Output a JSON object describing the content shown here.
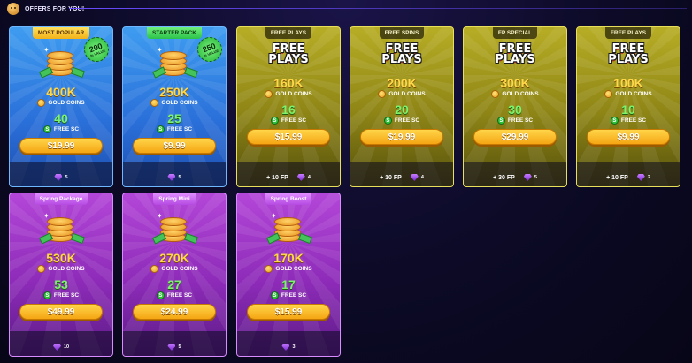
{
  "header": {
    "title": "OFFERS FOR YOU!"
  },
  "cards": [
    {
      "tag": "MOST POPULAR",
      "badge_num": "200",
      "badge_sub": "% VALUE",
      "coins": "400K",
      "coins_label": "GOLD COINS",
      "sc": "40",
      "sc_label": "FREE SC",
      "price": "$19.99",
      "fp": "",
      "gems": "5"
    },
    {
      "tag": "STARTER PACK",
      "badge_num": "250",
      "badge_sub": "% VALUE",
      "coins": "250K",
      "coins_label": "GOLD COINS",
      "sc": "25",
      "sc_label": "FREE SC",
      "price": "$9.99",
      "fp": "",
      "gems": "5"
    },
    {
      "tag": "FREE PLAYS",
      "art_line1": "FREE",
      "art_line2": "PLAYS",
      "coins": "160K",
      "coins_label": "GOLD COINS",
      "sc": "16",
      "sc_label": "FREE SC",
      "price": "$15.99",
      "fp": "+ 10 FP",
      "gems": "4"
    },
    {
      "tag": "FREE SPINS",
      "art_line1": "FREE",
      "art_line2": "PLAYS",
      "coins": "200K",
      "coins_label": "GOLD COINS",
      "sc": "20",
      "sc_label": "FREE SC",
      "price": "$19.99",
      "fp": "+ 10 FP",
      "gems": "4"
    },
    {
      "tag": "FP SPECIAL",
      "art_line1": "FREE",
      "art_line2": "PLAYS",
      "coins": "300K",
      "coins_label": "GOLD COINS",
      "sc": "30",
      "sc_label": "FREE SC",
      "price": "$29.99",
      "fp": "+ 30 FP",
      "gems": "5"
    },
    {
      "tag": "FREE PLAYS",
      "art_line1": "FREE",
      "art_line2": "PLAYS",
      "coins": "100K",
      "coins_label": "GOLD COINS",
      "sc": "10",
      "sc_label": "FREE SC",
      "price": "$9.99",
      "fp": "+ 10 FP",
      "gems": "2"
    },
    {
      "tag": "Spring Package",
      "coins": "530K",
      "coins_label": "GOLD COINS",
      "sc": "53",
      "sc_label": "FREE SC",
      "price": "$49.99",
      "fp": "",
      "gems": "10"
    },
    {
      "tag": "Spring Mini",
      "coins": "270K",
      "coins_label": "GOLD COINS",
      "sc": "27",
      "sc_label": "FREE SC",
      "price": "$24.99",
      "fp": "",
      "gems": "5"
    },
    {
      "tag": "Spring Boost",
      "coins": "170K",
      "coins_label": "GOLD COINS",
      "sc": "17",
      "sc_label": "FREE SC",
      "price": "$15.99",
      "fp": "",
      "gems": "3"
    }
  ],
  "colors": {
    "blue": "#2a6fd9",
    "yellow": "#8d8416",
    "purple": "#8d2bb8",
    "price_button": "#f5a513",
    "sc_green": "#7cf36c",
    "gold": "#ffd84a"
  }
}
